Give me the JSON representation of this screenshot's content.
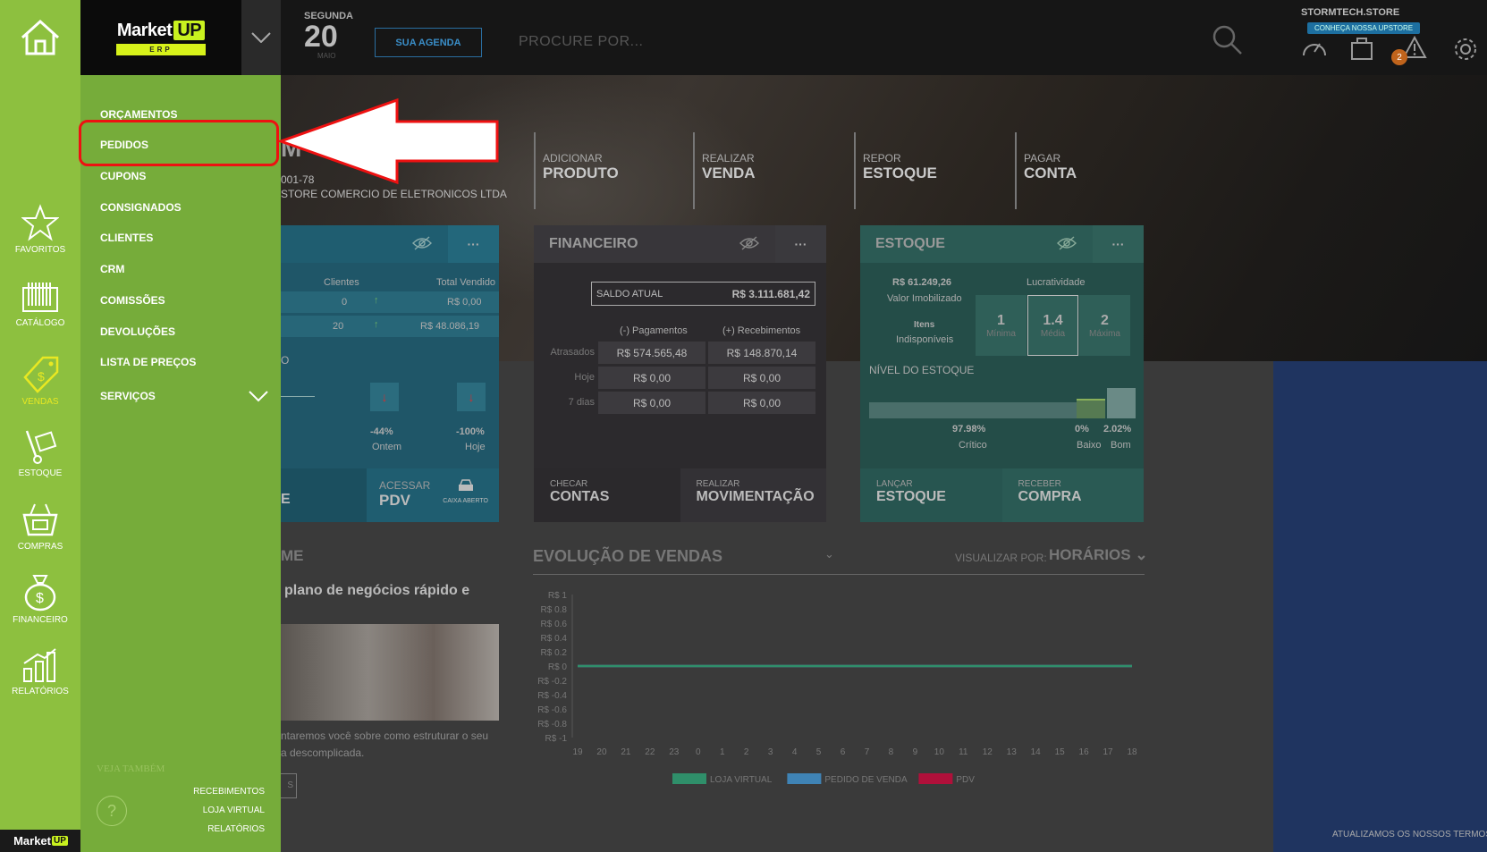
{
  "header": {
    "logo_text": "Market",
    "logo_up": "UP",
    "logo_erp": "ERP",
    "date_weekday": "SEGUNDA",
    "date_day": "20",
    "date_month": "MAIO",
    "agenda_label": "SUA AGENDA",
    "search_placeholder": "PROCURE POR...",
    "store_name": "STORMTECH.STORE",
    "upstore_badge": "CONHEÇA NOSSA UPSTORE",
    "notif_count": "2"
  },
  "hero": {
    "company_title": "M",
    "company_id": "001-78",
    "company_name": "STORE COMERCIO DE ELETRONICOS LTDA",
    "quick_actions": [
      {
        "top": "ADICIONAR",
        "bottom": "PRODUTO"
      },
      {
        "top": "REALIZAR",
        "bottom": "VENDA"
      },
      {
        "top": "REPOR",
        "bottom": "ESTOQUE"
      },
      {
        "top": "PAGAR",
        "bottom": "CONTA"
      }
    ]
  },
  "vendas_card": {
    "col_clientes": "Clientes",
    "col_total": "Total Vendido",
    "row1_clientes": "0",
    "row1_total": "R$ 0,00",
    "row2_clientes": "20",
    "row2_total": "R$ 48.086,19",
    "partial_o": "O",
    "pct_ontem": "-44%",
    "pct_ontem_lbl": "Ontem",
    "pct_hoje": "-100%",
    "pct_hoje_lbl": "Hoje",
    "foot_top": "ACESSAR",
    "foot_bottom": "PDV",
    "caixa": "CAIXA ABERTO",
    "foot_left_partial": "E"
  },
  "fin_card": {
    "title": "FINANCEIRO",
    "saldo_label": "SALDO ATUAL",
    "saldo_value": "R$ 3.111.681,42",
    "col_pag": "(-) Pagamentos",
    "col_rec": "(+) Recebimentos",
    "rows": [
      {
        "label": "Atrasados",
        "pag": "R$ 574.565,48",
        "rec": "R$ 148.870,14"
      },
      {
        "label": "Hoje",
        "pag": "R$ 0,00",
        "rec": "R$ 0,00"
      },
      {
        "label": "7 dias",
        "pag": "R$ 0,00",
        "rec": "R$ 0,00"
      }
    ],
    "foot1_top": "CHECAR",
    "foot1_bottom": "CONTAS",
    "foot2_top": "REALIZAR",
    "foot2_bottom": "MOVIMENTAÇÃO"
  },
  "est_card": {
    "title": "ESTOQUE",
    "valor": "R$ 61.249,26",
    "valor_lbl": "Valor Imobilizado",
    "itens": "Itens",
    "itens_lbl": "Indisponíveis",
    "lucr": "Lucratividade",
    "boxes": [
      {
        "n": "1",
        "t": "Mínima"
      },
      {
        "n": "1.4",
        "t": "Média"
      },
      {
        "n": "2",
        "t": "Máxima"
      }
    ],
    "nivel": "NÍVEL DO ESTOQUE",
    "pct_critico": "97.98%",
    "lbl_critico": "Crítico",
    "pct_baixo": "0%",
    "lbl_baixo": "Baixo",
    "pct_bom": "2.02%",
    "lbl_bom": "Bom",
    "foot1_top": "LANÇAR",
    "foot1_bottom": "ESTOQUE",
    "foot2_top": "RECEBER",
    "foot2_bottom": "COMPRA"
  },
  "lower": {
    "left_title": "ME",
    "left_heading": "plano de negócios rápido e",
    "left_text1": "ntaremos você sobre como estruturar o seu",
    "left_text2": "a descomplicada.",
    "left_btn": "S",
    "evol_title": "EVOLUÇÃO DE VENDAS",
    "vis_label": "VISUALIZAR POR:",
    "vis_value": "HORÁRIOS",
    "footer_note": "ATUALIZAMOS OS NOSSOS TERMOS"
  },
  "chart_data": {
    "type": "line",
    "title": "EVOLUÇÃO DE VENDAS",
    "x": [
      "19",
      "20",
      "21",
      "22",
      "23",
      "0",
      "1",
      "2",
      "3",
      "4",
      "5",
      "6",
      "7",
      "8",
      "9",
      "10",
      "11",
      "12",
      "13",
      "14",
      "15",
      "16",
      "17",
      "18"
    ],
    "y_ticks": [
      "R$ 1",
      "R$ 0.8",
      "R$ 0.6",
      "R$ 0.4",
      "R$ 0.2",
      "R$ 0",
      "R$ -0.2",
      "R$ -0.4",
      "R$ -0.6",
      "R$ -0.8",
      "R$ -1"
    ],
    "ylim": [
      -1,
      1
    ],
    "series": [
      {
        "name": "LOJA VIRTUAL",
        "color": "#2f8f6a",
        "values": [
          0,
          0,
          0,
          0,
          0,
          0,
          0,
          0,
          0,
          0,
          0,
          0,
          0,
          0,
          0,
          0,
          0,
          0,
          0,
          0,
          0,
          0,
          0,
          0
        ]
      },
      {
        "name": "PEDIDO DE VENDA",
        "color": "#3f83b5",
        "values": [
          0,
          0,
          0,
          0,
          0,
          0,
          0,
          0,
          0,
          0,
          0,
          0,
          0,
          0,
          0,
          0,
          0,
          0,
          0,
          0,
          0,
          0,
          0,
          0
        ]
      },
      {
        "name": "PDV",
        "color": "#b0103a",
        "values": [
          0,
          0,
          0,
          0,
          0,
          0,
          0,
          0,
          0,
          0,
          0,
          0,
          0,
          0,
          0,
          0,
          0,
          0,
          0,
          0,
          0,
          0,
          0,
          0
        ]
      }
    ]
  },
  "rail": [
    {
      "label": "FAVORITOS",
      "icon": "star-icon"
    },
    {
      "label": "CATÁLOGO",
      "icon": "barcode-icon"
    },
    {
      "label": "VENDAS",
      "icon": "price-tag-icon"
    },
    {
      "label": "ESTOQUE",
      "icon": "hand-truck-icon"
    },
    {
      "label": "COMPRAS",
      "icon": "basket-icon"
    },
    {
      "label": "FINANCEIRO",
      "icon": "money-bag-icon"
    },
    {
      "label": "RELATÓRIOS",
      "icon": "bar-chart-icon"
    }
  ],
  "rail_footer": {
    "text": "Market",
    "up": "UP"
  },
  "submenu": {
    "items": [
      "ORÇAMENTOS",
      "PEDIDOS",
      "CUPONS",
      "CONSIGNADOS",
      "CLIENTES",
      "CRM",
      "COMISSÕES",
      "DEVOLUÇÕES",
      "LISTA DE PREÇOS",
      "SERVIÇOS"
    ],
    "veja_title": "VEJA TAMBÉM",
    "veja_links": [
      "RECEBIMENTOS",
      "LOJA VIRTUAL",
      "RELATÓRIOS"
    ],
    "help": "?"
  },
  "colors": {
    "accent_green": "#8dc03f",
    "submenu_green": "#76ac3a",
    "highlight_red": "#e11111"
  }
}
